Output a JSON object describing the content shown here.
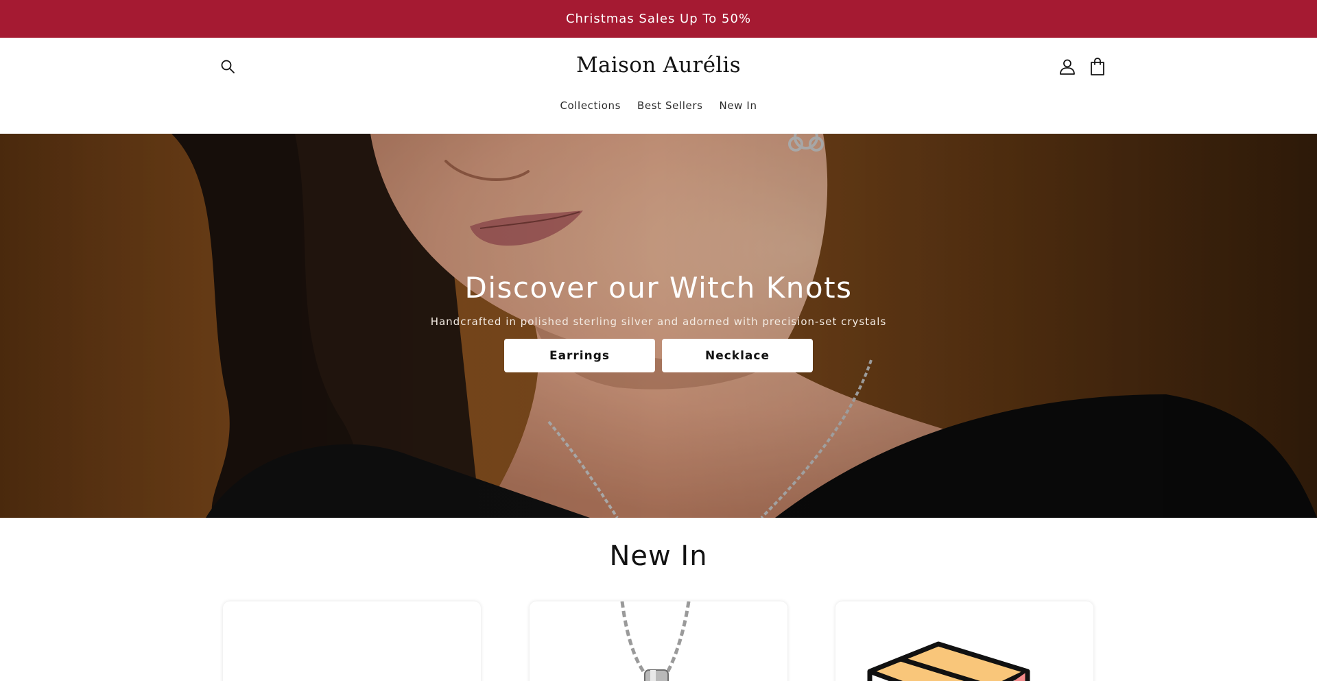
{
  "announcement": {
    "text": "Christmas Sales Up To 50%",
    "background": "#a51a32"
  },
  "header": {
    "search_icon": "search-icon",
    "logo": "Maison Aurélis",
    "account_icon": "account-icon",
    "cart_icon": "cart-icon",
    "nav": [
      {
        "label": "Collections"
      },
      {
        "label": "Best Sellers"
      },
      {
        "label": "New In"
      }
    ]
  },
  "hero": {
    "title": "Discover our Witch Knots",
    "subtitle": "Handcrafted in polished sterling silver and adorned with precision-set crystals",
    "buttons": [
      {
        "label": "Earrings"
      },
      {
        "label": "Necklace"
      }
    ]
  },
  "new_in": {
    "title": "New In",
    "products": [
      {
        "image": "blank"
      },
      {
        "image": "necklace-pendant"
      },
      {
        "image": "box-icon"
      }
    ]
  }
}
